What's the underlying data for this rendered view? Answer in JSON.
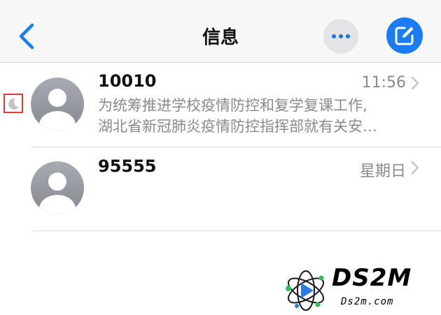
{
  "header": {
    "title": "信息",
    "back_icon": "chevron-left-icon",
    "more_icon": "ellipsis-icon",
    "compose_icon": "compose-icon",
    "accent_color": "#1a7cf5"
  },
  "conversations": [
    {
      "sender": "10010",
      "time": "11:56",
      "preview_line1": "为统筹推进学校疫情防控和复学复课工作,",
      "preview_line2": "湖北省新冠肺炎疫情防控指挥部就有关安…",
      "muted": true
    },
    {
      "sender": "95555",
      "time": "星期日",
      "preview_line1": "",
      "preview_line2": ""
    }
  ],
  "watermark": {
    "brand": "DS2M",
    "url": "Ds2m.com"
  }
}
